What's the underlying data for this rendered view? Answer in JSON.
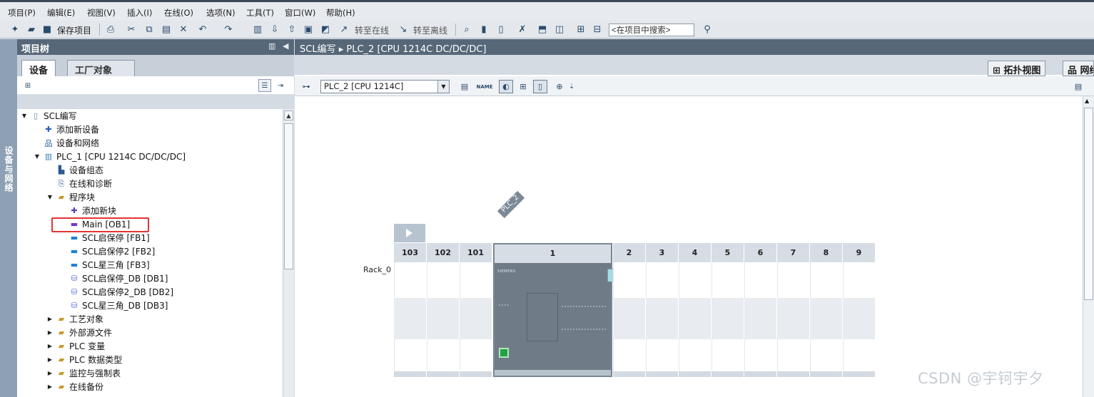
{
  "menu": [
    "项目(P)",
    "编辑(E)",
    "视图(V)",
    "插入(I)",
    "在线(O)",
    "选项(N)",
    "工具(T)",
    "窗口(W)",
    "帮助(H)"
  ],
  "toolbar": {
    "save_label": "保存项目",
    "go_online": "转至在线",
    "go_offline": "转至离线",
    "search_placeholder": "<在项目中搜索>"
  },
  "left_strip": {
    "label": "设备与网络"
  },
  "project_tree": {
    "title": "项目树",
    "tabs": [
      "设备",
      "工厂对象"
    ],
    "items": [
      {
        "label": "SCL编写",
        "icon": "project-icon",
        "expander": "down"
      },
      {
        "label": "添加新设备",
        "icon": "add-device-icon",
        "expander": ""
      },
      {
        "label": "设备和网络",
        "icon": "network-icon",
        "expander": ""
      },
      {
        "label": "PLC_1 [CPU 1214C DC/DC/DC]",
        "icon": "plc-icon",
        "expander": "down"
      },
      {
        "label": "设备组态",
        "icon": "device-config-icon",
        "expander": ""
      },
      {
        "label": "在线和诊断",
        "icon": "diagnostics-icon",
        "expander": ""
      },
      {
        "label": "程序块",
        "icon": "folder-icon",
        "expander": "down"
      },
      {
        "label": "添加新块",
        "icon": "add-block-icon",
        "expander": ""
      },
      {
        "label": "Main [OB1]",
        "icon": "ob-block-icon",
        "expander": ""
      },
      {
        "label": "SCL启保停 [FB1]",
        "icon": "fb-block-icon",
        "expander": ""
      },
      {
        "label": "SCL启保停2 [FB2]",
        "icon": "fb-block-icon",
        "expander": ""
      },
      {
        "label": "SCL星三角 [FB3]",
        "icon": "fb-block-icon",
        "expander": ""
      },
      {
        "label": "SCL启保停_DB [DB1]",
        "icon": "db-block-icon",
        "expander": ""
      },
      {
        "label": "SCL启保停2_DB [DB2]",
        "icon": "db-block-icon",
        "expander": ""
      },
      {
        "label": "SCL星三角_DB [DB3]",
        "icon": "db-block-icon",
        "expander": ""
      },
      {
        "label": "工艺对象",
        "icon": "folder-icon",
        "expander": "right"
      },
      {
        "label": "外部源文件",
        "icon": "folder-icon",
        "expander": "right"
      },
      {
        "label": "PLC 变量",
        "icon": "folder-icon",
        "expander": "right"
      },
      {
        "label": "PLC 数据类型",
        "icon": "folder-icon",
        "expander": "right"
      },
      {
        "label": "监控与强制表",
        "icon": "folder-icon",
        "expander": "right"
      },
      {
        "label": "在线备份",
        "icon": "folder-icon",
        "expander": "right"
      }
    ]
  },
  "editor": {
    "breadcrumb": [
      "SCL编写",
      "PLC_2 [CPU 1214C DC/DC/DC]"
    ],
    "view_tabs": [
      "拓扑视图",
      "网络视图"
    ],
    "device_select": "PLC_2 [CPU 1214C]",
    "plc_tag": "PLC_2",
    "rack_label": "Rack_0",
    "slots": [
      "103",
      "102",
      "101",
      "1",
      "2",
      "3",
      "4",
      "5",
      "6",
      "7",
      "8",
      "9"
    ],
    "cpu_brand": "SIEMENS"
  },
  "watermark": "CSDN @宇钶宇夕",
  "colors": {
    "panel_header": "#566778",
    "highlight": "#e53333",
    "cpu": "#6f7c88",
    "status_green": "#23a246"
  }
}
